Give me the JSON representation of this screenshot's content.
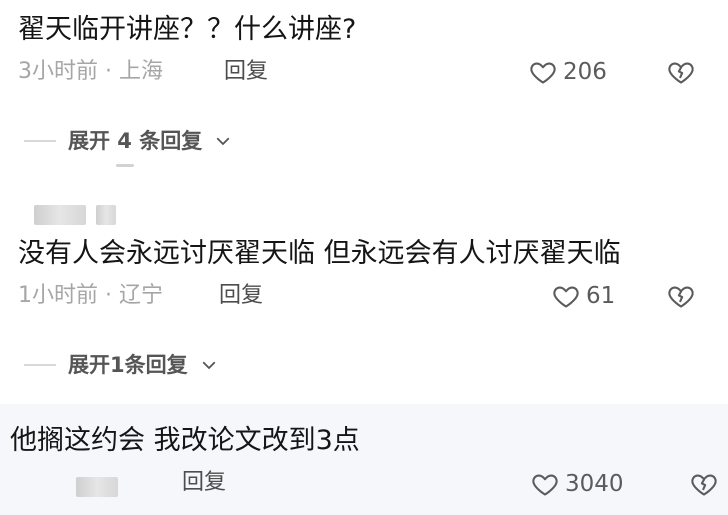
{
  "comments": [
    {
      "text": "翟天临开讲座？？什么讲座?",
      "meta": "3小时前 · 上海",
      "reply_label": "回复",
      "likes": "206",
      "expand_label": "展开 4 条回复"
    },
    {
      "text": "没有人会永远讨厌翟天临 但永远会有人讨厌翟天临",
      "meta": "1小时前 · 辽宁",
      "reply_label": "回复",
      "likes": "61",
      "expand_label": "展开1条回复"
    },
    {
      "text": "他搁这约会 我改论文改到3点",
      "reply_label": "回复",
      "likes": "3040"
    }
  ],
  "colors": {
    "text": "#151515",
    "meta": "#a6a6a6",
    "reply": "#4d4d4d",
    "like_icon": "#5b5b5b",
    "bottom_bg": "#f6f7fb"
  },
  "icons": {
    "like": "heart-outline-icon",
    "dislike": "broken-heart-icon",
    "expand": "chevron-down-icon"
  }
}
